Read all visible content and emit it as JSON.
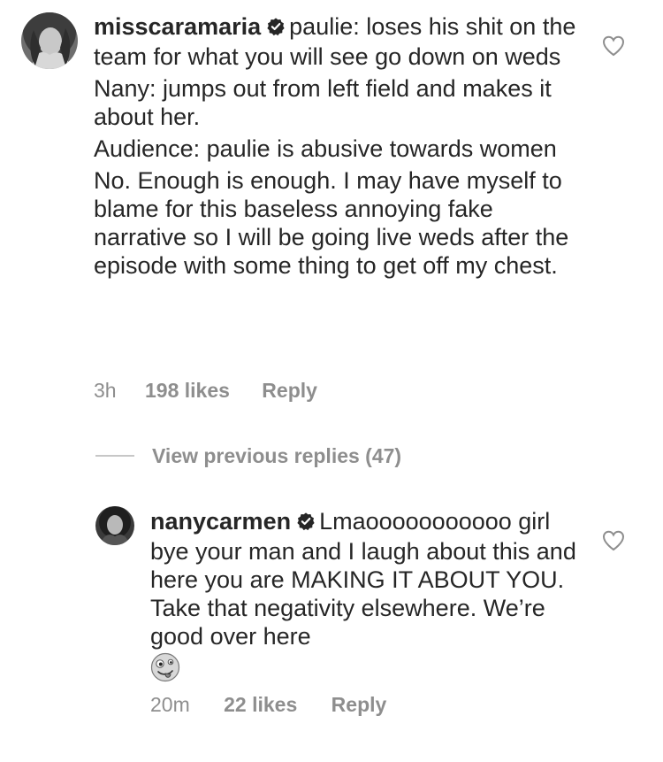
{
  "comments": [
    {
      "username": "misscaramaria",
      "verified": true,
      "lines": [
        "paulie: loses his shit on the team for what you will see go down on weds",
        "Nany: jumps out from left field and makes it about her.",
        "Audience: paulie is abusive towards women",
        "No. Enough is enough. I may have myself to blame for this baseless annoying fake narrative so I will be going live weds after the episode with some thing to get off my chest."
      ],
      "time": "3h",
      "likes": "198 likes",
      "reply_label": "Reply"
    },
    {
      "username": "nanycarmen",
      "verified": true,
      "lines": [
        "Lmaooooooooooo girl bye your man and I laugh about this and here you are MAKING IT ABOUT YOU. Take that negativity elsewhere. We’re good over here"
      ],
      "emoji": "crazy-face-emoji",
      "time": "20m",
      "likes": "22 likes",
      "reply_label": "Reply"
    }
  ],
  "view_previous_replies": "View previous replies (47)",
  "icons": {
    "heart": "heart-outline-icon",
    "verified": "verified-badge-icon"
  },
  "colors": {
    "text": "#262626",
    "muted": "#8e8e8e",
    "divider": "#c7c7c7"
  }
}
